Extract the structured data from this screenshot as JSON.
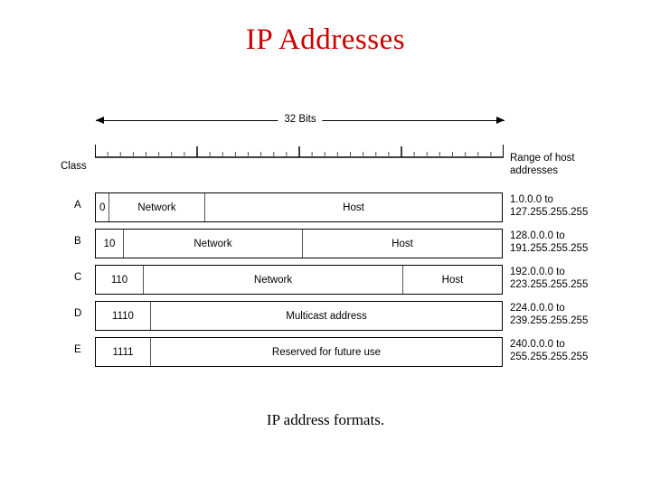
{
  "slide": {
    "title": "IP Addresses",
    "caption": "IP address formats."
  },
  "diagram": {
    "width_label": "32 Bits",
    "class_header": "Class",
    "range_header_line1": "Range of host",
    "range_header_line2": "addresses",
    "ruler": {
      "total_bits": 32,
      "major_tick_every": 8
    },
    "rows": [
      {
        "letter": "A",
        "prefix": "0",
        "fields": [
          {
            "label": "Network"
          },
          {
            "label": "Host"
          }
        ],
        "range_line1": "1.0.0.0 to",
        "range_line2": "127.255.255.255"
      },
      {
        "letter": "B",
        "prefix": "10",
        "fields": [
          {
            "label": "Network"
          },
          {
            "label": "Host"
          }
        ],
        "range_line1": "128.0.0.0 to",
        "range_line2": "191.255.255.255"
      },
      {
        "letter": "C",
        "prefix": "110",
        "fields": [
          {
            "label": "Network"
          },
          {
            "label": "Host"
          }
        ],
        "range_line1": "192.0.0.0 to",
        "range_line2": "223.255.255.255"
      },
      {
        "letter": "D",
        "prefix": "1110",
        "fields": [
          {
            "label": "Multicast address"
          }
        ],
        "range_line1": "224.0.0.0 to",
        "range_line2": "239.255.255.255"
      },
      {
        "letter": "E",
        "prefix": "1111",
        "fields": [
          {
            "label": "Reserved for future use"
          }
        ],
        "range_line1": "240.0.0.0 to",
        "range_line2": "255.255.255.255"
      }
    ]
  },
  "colors": {
    "title": "#cc0000",
    "text": "#000000",
    "background": "#ffffff"
  }
}
